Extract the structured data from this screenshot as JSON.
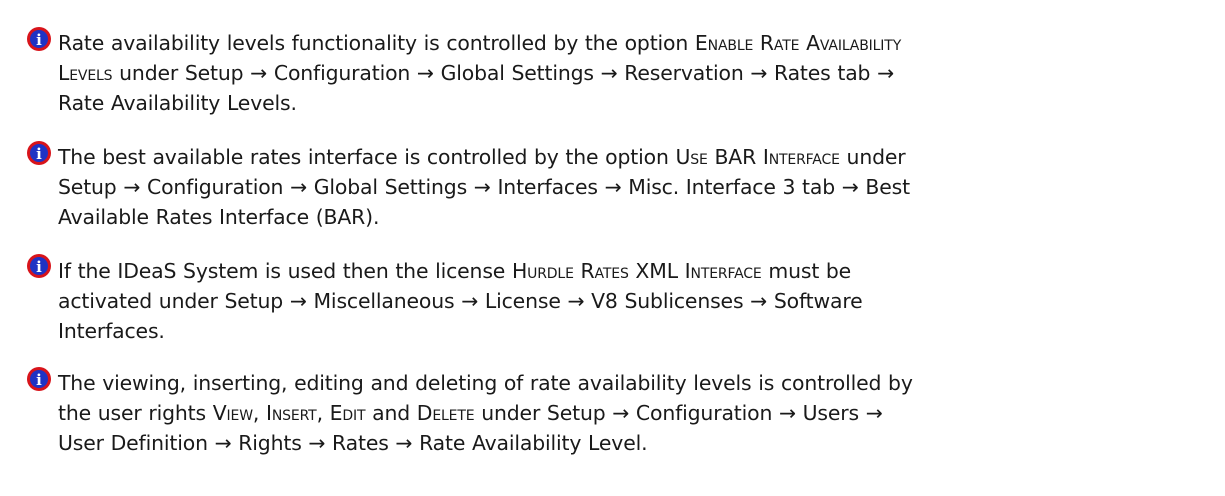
{
  "icon": {
    "name": "info-icon",
    "glyph": "i",
    "ring_color": "#d8141b",
    "fill_color": "#1f33c4",
    "glyph_color": "#ffffff"
  },
  "notes": [
    {
      "lines": [
        [
          {
            "text": "Rate availability levels functionality is controlled by the option "
          },
          {
            "text": "Enable Rate Availability",
            "sc": true
          }
        ],
        [
          {
            "text": "Levels",
            "sc": true
          },
          {
            "text": " under Setup → Configuration → Global Settings → Reservation → Rates tab →"
          }
        ],
        [
          {
            "text": "Rate Availability Levels."
          }
        ]
      ]
    },
    {
      "lines": [
        [
          {
            "text": "The best available rates interface is controlled by the option "
          },
          {
            "text": "Use BAR Interface",
            "sc": true
          },
          {
            "text": " under"
          }
        ],
        [
          {
            "text": "Setup → Configuration → Global Settings → Interfaces → Misc. Interface 3 tab → Best"
          }
        ],
        [
          {
            "text": "Available Rates Interface (BAR)."
          }
        ]
      ]
    },
    {
      "lines": [
        [
          {
            "text": "If the IDeaS System is used then the license "
          },
          {
            "text": "Hurdle Rates XML Interface",
            "sc": true
          },
          {
            "text": " must be"
          }
        ],
        [
          {
            "text": "activated under Setup → Miscellaneous → License → V8 Sublicenses → Software"
          }
        ],
        [
          {
            "text": "Interfaces."
          }
        ]
      ]
    },
    {
      "lines": [
        [
          {
            "text": "The viewing, inserting, editing and deleting of rate availability levels is controlled by"
          }
        ],
        [
          {
            "text": "the user rights "
          },
          {
            "text": "View",
            "sc": true
          },
          {
            "text": ", "
          },
          {
            "text": "Insert",
            "sc": true
          },
          {
            "text": ", "
          },
          {
            "text": "Edit",
            "sc": true
          },
          {
            "text": " and "
          },
          {
            "text": "Delete",
            "sc": true
          },
          {
            "text": " under Setup → Configuration → Users →"
          }
        ],
        [
          {
            "text": "User Definition → Rights → Rates → Rate Availability Level."
          }
        ]
      ]
    }
  ]
}
